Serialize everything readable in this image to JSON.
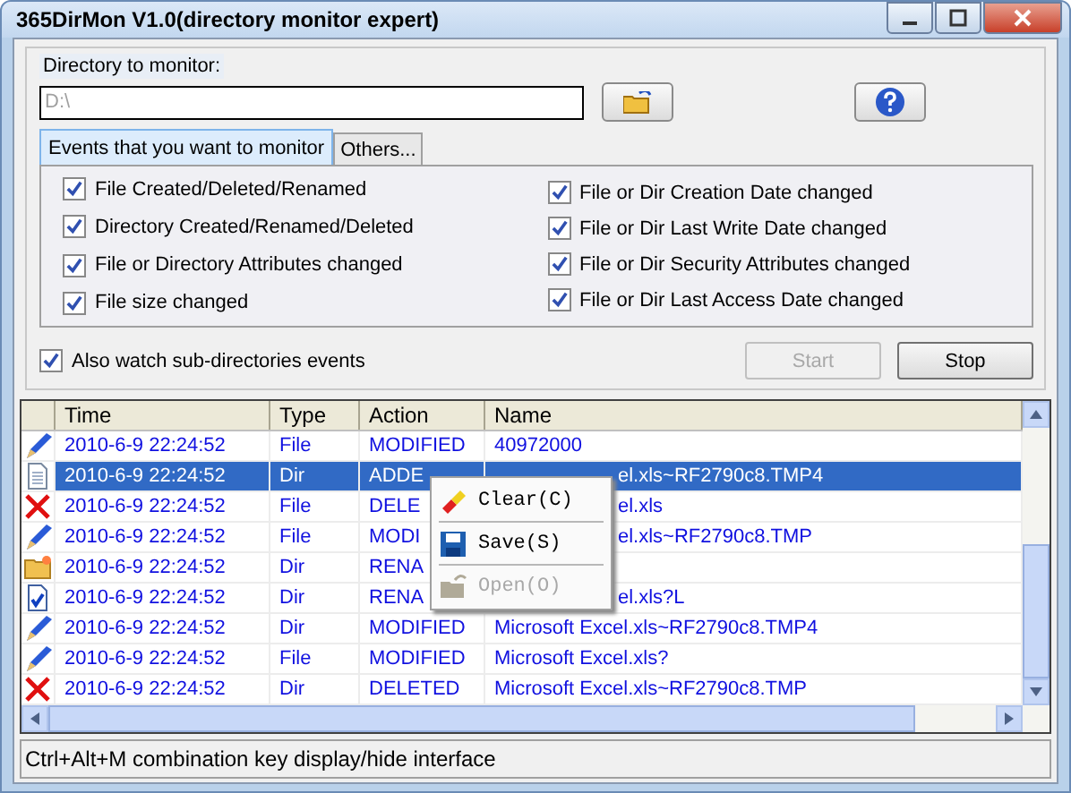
{
  "window": {
    "title": "365DirMon V1.0(directory monitor expert)"
  },
  "directory": {
    "label": "Directory to monitor:",
    "value": "D:\\"
  },
  "tabs": [
    {
      "label": "Events that you want to monitor",
      "selected": true
    },
    {
      "label": "Others...",
      "selected": false
    }
  ],
  "events_left": [
    {
      "label": "File Created/Deleted/Renamed",
      "checked": true
    },
    {
      "label": "Directory Created/Renamed/Deleted",
      "checked": true
    },
    {
      "label": "File or Directory Attributes changed",
      "checked": true
    },
    {
      "label": "File size changed",
      "checked": true
    }
  ],
  "events_right": [
    {
      "label": "File or Dir Creation Date changed",
      "checked": true
    },
    {
      "label": "File or Dir Last Write Date changed",
      "checked": true
    },
    {
      "label": "File or Dir Security Attributes changed",
      "checked": true
    },
    {
      "label": "File or Dir Last Access Date changed",
      "checked": true
    }
  ],
  "subdirs": {
    "label": "Also watch sub-directories events",
    "checked": true
  },
  "buttons": [
    {
      "label": "Start",
      "disabled": true
    },
    {
      "label": "Stop",
      "disabled": false
    }
  ],
  "table": {
    "columns": [
      "Time",
      "Type",
      "Action",
      "Name"
    ],
    "rows": [
      {
        "kind": "modified",
        "time": "2010-6-9 22:24:52",
        "type": "File",
        "action": "MODIFIED",
        "name": "40972000",
        "selected": false,
        "under_menu": false
      },
      {
        "kind": "document",
        "time": "2010-6-9 22:24:52",
        "type": "Dir",
        "action": "ADDE",
        "name": "el.xls~RF2790c8.TMP4",
        "selected": true,
        "under_menu": true
      },
      {
        "kind": "deleted",
        "time": "2010-6-9 22:24:52",
        "type": "File",
        "action": "DELE",
        "name": "el.xls",
        "selected": false,
        "under_menu": true
      },
      {
        "kind": "modified",
        "time": "2010-6-9 22:24:52",
        "type": "File",
        "action": "MODI",
        "name": "el.xls~RF2790c8.TMP",
        "selected": false,
        "under_menu": true
      },
      {
        "kind": "folder",
        "time": "2010-6-9 22:24:52",
        "type": "Dir",
        "action": "RENA",
        "selected": false
      },
      {
        "kind": "checked-document",
        "time": "2010-6-9 22:24:52",
        "type": "Dir",
        "action": "RENA",
        "name": "el.xls?L",
        "selected": false,
        "under_menu": true
      },
      {
        "kind": "modified",
        "time": "2010-6-9 22:24:52",
        "type": "Dir",
        "action": "MODIFIED",
        "name": "Microsoft Excel.xls~RF2790c8.TMP4",
        "selected": false,
        "under_menu": false
      },
      {
        "kind": "modified",
        "time": "2010-6-9 22:24:52",
        "type": "File",
        "action": "MODIFIED",
        "name": "Microsoft Excel.xls?",
        "selected": false,
        "under_menu": false
      },
      {
        "kind": "deleted",
        "time": "2010-6-9 22:24:52",
        "type": "Dir",
        "action": "DELETED",
        "name": "Microsoft Excel.xls~RF2790c8.TMP",
        "selected": false,
        "under_menu": false
      }
    ]
  },
  "context_menu": [
    {
      "kind": "eraser",
      "label": "Clear(C)",
      "disabled": false
    },
    {
      "kind": "disk",
      "label": "Save(S)",
      "disabled": false
    },
    {
      "kind": "folder",
      "label": "Open(O)",
      "disabled": true
    }
  ],
  "status_bar": "Ctrl+Alt+M combination key display/hide interface"
}
